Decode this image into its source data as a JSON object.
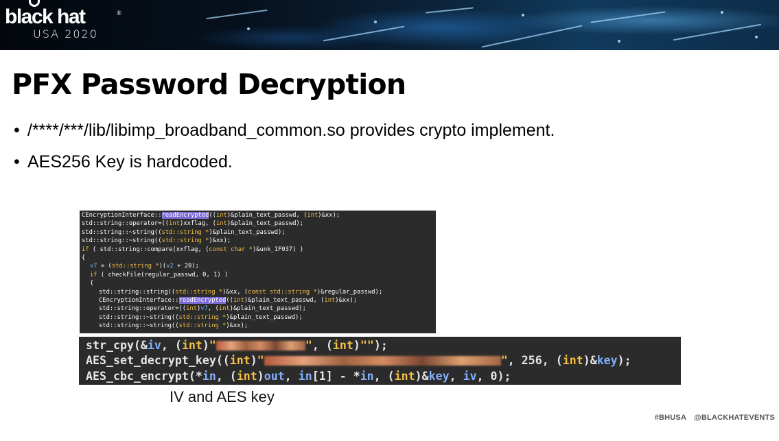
{
  "banner": {
    "logo_text": "black hat",
    "logo_reg": "®",
    "logo_sub": "USA 2020"
  },
  "slide": {
    "title": "PFX Password Decryption",
    "bullets": [
      "/****/***/lib/libimp_broadband_common.so provides crypto implement.",
      "AES256 Key is hardcoded."
    ],
    "bullet_mark": "•",
    "caption": "IV and AES key"
  },
  "code_snippet_1": {
    "lines": [
      {
        "indent": 0,
        "parts": [
          [
            "",
            "CEncryptionInterface::"
          ],
          [
            "hl",
            "readEncrypted"
          ],
          [
            "",
            "(("
          ],
          [
            "kw",
            "int"
          ],
          [
            "",
            ")&plain_text_passwd, ("
          ],
          [
            "kw",
            "int"
          ],
          [
            "",
            ")&xx);"
          ]
        ]
      },
      {
        "indent": 0,
        "parts": [
          [
            "",
            "std::string::operator=(("
          ],
          [
            "kw",
            "int"
          ],
          [
            "",
            ")xxflag, ("
          ],
          [
            "kw",
            "int"
          ],
          [
            "",
            ")&plain_text_passwd);"
          ]
        ]
      },
      {
        "indent": 0,
        "parts": [
          [
            "",
            "std::string::~string(("
          ],
          [
            "kw",
            "std::string *"
          ],
          [
            "",
            ")&plain_text_passwd);"
          ]
        ]
      },
      {
        "indent": 0,
        "parts": [
          [
            "",
            "std::string::~string(("
          ],
          [
            "kw",
            "std::string *"
          ],
          [
            "",
            ")&xx);"
          ]
        ]
      },
      {
        "indent": 0,
        "parts": [
          [
            "kw",
            "if"
          ],
          [
            "",
            " ( std::string::compare(xxflag, ("
          ],
          [
            "kw",
            "const char *"
          ],
          [
            "",
            ")&unk_1F037) )"
          ]
        ]
      },
      {
        "indent": 0,
        "parts": [
          [
            "",
            "{"
          ]
        ]
      },
      {
        "indent": 1,
        "parts": [
          [
            "var",
            "v7"
          ],
          [
            "",
            " = ("
          ],
          [
            "kw",
            "std::string *"
          ],
          [
            "",
            ")("
          ],
          [
            "var",
            "v2"
          ],
          [
            "",
            " + 20);"
          ]
        ]
      },
      {
        "indent": 1,
        "parts": [
          [
            "kw",
            "if"
          ],
          [
            "",
            "",
            " "
          ],
          [
            "",
            " ( checkFile(regular_passwd, 0, 1) )"
          ]
        ]
      },
      {
        "indent": 1,
        "parts": [
          [
            "",
            "{"
          ]
        ]
      },
      {
        "indent": 2,
        "parts": [
          [
            "",
            "std::string::string(("
          ],
          [
            "kw",
            "std::string *"
          ],
          [
            "",
            ")&xx, ("
          ],
          [
            "kw",
            "const std::string *"
          ],
          [
            "",
            ")&regular_passwd);"
          ]
        ]
      },
      {
        "indent": 2,
        "parts": [
          [
            "",
            "CEncryptionInterface::"
          ],
          [
            "hl",
            "readEncrypted"
          ],
          [
            "",
            "(("
          ],
          [
            "kw",
            "int"
          ],
          [
            "",
            ")&plain_text_passwd, ("
          ],
          [
            "kw",
            "int"
          ],
          [
            "",
            ")&xx);"
          ]
        ]
      },
      {
        "indent": 2,
        "parts": [
          [
            "",
            "std::string::operator=(("
          ],
          [
            "kw",
            "int"
          ],
          [
            "",
            ")"
          ],
          [
            "var",
            "v7"
          ],
          [
            "",
            ", ("
          ],
          [
            "kw",
            "int"
          ],
          [
            "",
            ")&plain_text_passwd);"
          ]
        ]
      },
      {
        "indent": 2,
        "parts": [
          [
            "",
            "std::string::~string(("
          ],
          [
            "kw",
            "std::string *"
          ],
          [
            "",
            ")&plain_text_passwd);"
          ]
        ]
      },
      {
        "indent": 2,
        "parts": [
          [
            "",
            "std::string::~string(("
          ],
          [
            "kw",
            "std::string *"
          ],
          [
            "",
            ")&xx);"
          ]
        ]
      }
    ]
  },
  "code_snippet_2": {
    "lines": [
      {
        "parts": [
          [
            "",
            "str_cpy(&"
          ],
          [
            "var",
            "iv"
          ],
          [
            "",
            ", ("
          ],
          [
            "kw",
            "int"
          ],
          [
            "",
            ")"
          ],
          [
            "str",
            "\""
          ],
          [
            "blur",
            "130"
          ],
          [
            "str",
            "\""
          ],
          [
            "",
            ", ("
          ],
          [
            "kw",
            "int"
          ],
          [
            "",
            ")"
          ],
          [
            "str",
            "\"\""
          ],
          [
            "",
            ");"
          ]
        ]
      },
      {
        "parts": [
          [
            "",
            "AES_set_decrypt_key(("
          ],
          [
            "kw",
            "int"
          ],
          [
            "",
            ")"
          ],
          [
            "str",
            "\""
          ],
          [
            "blur",
            "345"
          ],
          [
            "str",
            "\""
          ],
          [
            "",
            ", 256, ("
          ],
          [
            "kw",
            "int"
          ],
          [
            "",
            ")&"
          ],
          [
            "var",
            "key"
          ],
          [
            "",
            ");"
          ]
        ]
      },
      {
        "parts": [
          [
            "",
            "AES_cbc_encrypt(*"
          ],
          [
            "var",
            "in"
          ],
          [
            "",
            ", ("
          ],
          [
            "kw",
            "int"
          ],
          [
            "",
            ")"
          ],
          [
            "var",
            "out"
          ],
          [
            "",
            ", "
          ],
          [
            "var",
            "in"
          ],
          [
            "",
            "[1] - *"
          ],
          [
            "var",
            "in"
          ],
          [
            "",
            ", ("
          ],
          [
            "kw",
            "int"
          ],
          [
            "",
            ")&"
          ],
          [
            "var",
            "key"
          ],
          [
            "",
            ", "
          ],
          [
            "var",
            "iv"
          ],
          [
            "",
            ", 0);"
          ]
        ]
      }
    ]
  },
  "footer": {
    "hashtag": "#BHUSA",
    "handle": "@BLACKHATEVENTS"
  },
  "colors": {
    "code_bg": "#2b2b2b",
    "keyword": "#f5c044",
    "variable": "#82b0ff",
    "highlight": "#7b6bd6"
  }
}
